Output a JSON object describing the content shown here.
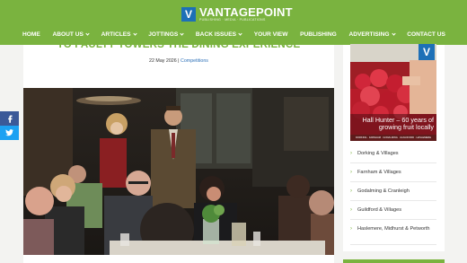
{
  "brand": {
    "logo_letter": "V",
    "name": "VANTAGEPOINT",
    "tagline": "PUBLISHING · MEDIA · PUBLICATIONS",
    "accent": "#7ab33f",
    "logo_blue": "#1d70b7"
  },
  "nav": [
    {
      "label": "HOME",
      "dropdown": false
    },
    {
      "label": "ABOUT US",
      "dropdown": true
    },
    {
      "label": "ARTICLES",
      "dropdown": true
    },
    {
      "label": "JOTTINGS",
      "dropdown": true
    },
    {
      "label": "BACK ISSUES",
      "dropdown": true
    },
    {
      "label": "YOUR VIEW",
      "dropdown": false
    },
    {
      "label": "PUBLISHING",
      "dropdown": false
    },
    {
      "label": "ADVERTISING",
      "dropdown": true
    },
    {
      "label": "CONTACT US",
      "dropdown": false
    }
  ],
  "article": {
    "title": "TO FAULTY TOWERS THE DINING EXPERIENCE",
    "date": "22 May 2026",
    "separator": " | ",
    "category": "Competitions"
  },
  "share": [
    {
      "network": "facebook",
      "icon": "facebook-icon",
      "color": "#3b5998"
    },
    {
      "network": "twitter",
      "icon": "twitter-icon",
      "color": "#1da1f2"
    }
  ],
  "sidebar": {
    "cover": {
      "logo_letter": "V",
      "caption": "Hall Hunter – 60 years of growing fruit locally",
      "strip": "DORKING · FARNHAM · GODALMING · GUILDFORD · HASLEMERE"
    },
    "links": [
      {
        "label": "Dorking & Villages"
      },
      {
        "label": "Farnham & Villages"
      },
      {
        "label": "Godalming & Cranleigh"
      },
      {
        "label": "Guildford & Villages"
      },
      {
        "label": "Haslemere, Midhurst & Petworth"
      }
    ]
  }
}
